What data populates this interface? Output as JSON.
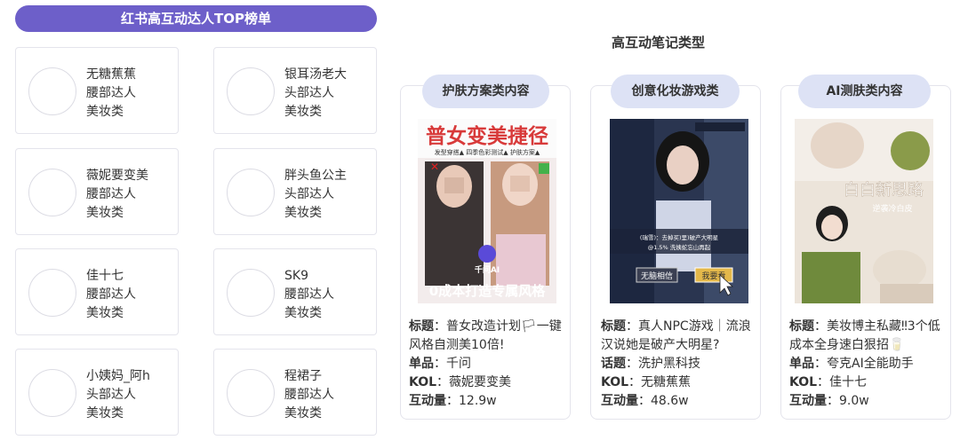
{
  "left_panel": {
    "title": "红书高互动达人TOP榜单",
    "kols": [
      {
        "name": "无糖蕉蕉",
        "tier": "腰部达人",
        "category": "美妆类"
      },
      {
        "name": "银耳汤老大",
        "tier": "头部达人",
        "category": "美妆类"
      },
      {
        "name": "薇妮要变美",
        "tier": "腰部达人",
        "category": "美妆类"
      },
      {
        "name": "胖头鱼公主",
        "tier": "头部达人",
        "category": "美妆类"
      },
      {
        "name": "佳十七",
        "tier": "腰部达人",
        "category": "美妆类"
      },
      {
        "name": "SK9",
        "tier": "腰部达人",
        "category": "美妆类"
      },
      {
        "name": "小姨妈_阿h",
        "tier": "头部达人",
        "category": "美妆类"
      },
      {
        "name": "程裙子",
        "tier": "腰部达人",
        "category": "美妆类"
      }
    ]
  },
  "right_panel": {
    "title": "高互动笔记类型",
    "notes": [
      {
        "tag": "护肤方案类内容",
        "thumb_headline": "普女变美捷径",
        "thumb_subline": "发型穿搭▲ 四季色彩测试▲ 护肤方案▲",
        "thumb_logo": "千问AI",
        "thumb_footer": "0成本打造专属风格",
        "title_label": "标题",
        "title": "普女改造计划🏳一键风格自测美10倍!",
        "field2_label": "单品",
        "field2": "千问",
        "kol_label": "KOL",
        "kol": "薇妮要变美",
        "engage_label": "互动量",
        "engage": "12.9w"
      },
      {
        "tag": "创意化妆游戏类",
        "thumb_caption": "(瑞雪)：去掉买)里)破产大明星",
        "thumb_sub": "@1.5% 洗姨蛇忘山再起",
        "thumb_btn1": "无脑相信",
        "thumb_btn2": "我要看",
        "title_label": "标题",
        "title": "真人NPC游戏｜流浪汉说她是破产大明星?",
        "field2_label": "话题",
        "field2": "洗护黑科技",
        "kol_label": "KOL",
        "kol": "无糖蕉蕉",
        "engage_label": "互动量",
        "engage": "48.6w"
      },
      {
        "tag": "AI测肤类内容",
        "thumb_headline": "白白新思路",
        "thumb_subline": "逆袭冷白皮",
        "title_label": "标题",
        "title": "美妆博主私藏‼3个低成本全身速白狠招🥛",
        "field2_label": "单品",
        "field2": "夸克AI全能助手",
        "kol_label": "KOL",
        "kol": "佳十七",
        "engage_label": "互动量",
        "engage": "9.0w"
      }
    ]
  },
  "colors": {
    "banner": "#6d5fc9",
    "tag_bg": "#dde2f5",
    "border": "#e4e4ec"
  }
}
